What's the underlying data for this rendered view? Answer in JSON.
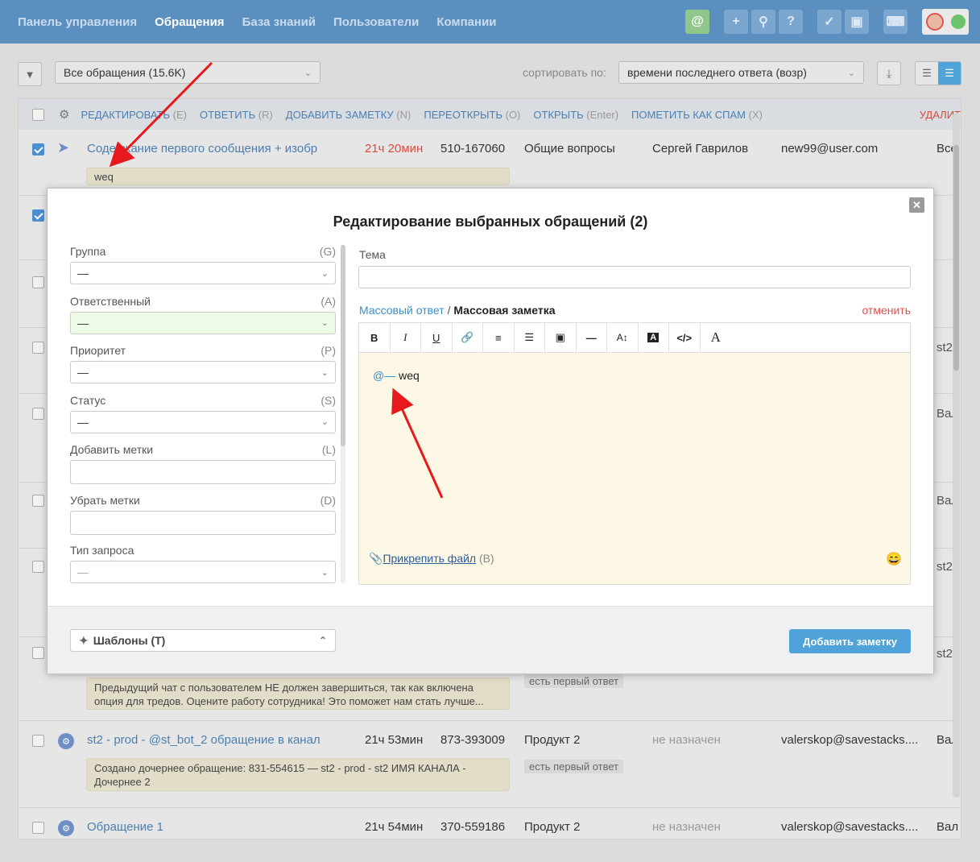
{
  "nav": {
    "links": [
      "Панель управления",
      "Обращения",
      "База знаний",
      "Пользователи",
      "Компании"
    ],
    "active": "Обращения"
  },
  "toolbar": {
    "filter_value": "Все обращения (15.6K)",
    "sort_label": "сортировать по:",
    "sort_value": "времени последнего ответа (возр)"
  },
  "actions": {
    "edit": "РЕДАКТИРОВАТЬ",
    "edit_key": "(E)",
    "reply": "ОТВЕТИТЬ",
    "reply_key": "(R)",
    "note": "ДОБАВИТЬ ЗАМЕТКУ",
    "note_key": "(N)",
    "reopen": "ПЕРЕОТКРЫТЬ",
    "reopen_key": "(O)",
    "open": "ОТКРЫТЬ",
    "open_key": "(Enter)",
    "spam": "ПОМЕТИТЬ КАК СПАМ",
    "spam_key": "(X)",
    "delete": "УДАЛИТ"
  },
  "rows": [
    {
      "subject": "Содержание первого сообщения + изобр",
      "time": "21ч 20мин",
      "id": "510-167060",
      "group": "Общие вопросы",
      "assignee": "Сергей Гаврилов",
      "email": "new99@user.com",
      "extra": "Все",
      "note": "weq"
    },
    {
      "note": "Предыдущий чат с пользователем НЕ должен завершиться, так как включена опция для тредов. Оцените работу сотрудника! Это поможет нам стать лучше...",
      "tag": "есть первый ответ"
    },
    {
      "subject": "st2 - prod - @st_bot_2 обращение в канал",
      "time": "21ч 53мин",
      "id": "873-393009",
      "group": "Продукт 2",
      "assignee": "не назначен",
      "email": "valerskop@savestacks....",
      "extra": "Вал",
      "note": "Создано дочернее обращение: 831-554615 — st2 - prod - st2 ИМЯ КАНАЛА - Дочернее 2",
      "tag": "есть первый ответ"
    },
    {
      "subject": "Обращение 1",
      "time": "21ч 54мин",
      "id": "370-559186",
      "group": "Продукт 2",
      "assignee": "не назначен",
      "email": "valerskop@savestacks....",
      "extra": "Вал"
    }
  ],
  "side_cut": [
    "st2",
    "Вал",
    "Вал",
    "st2",
    "st2"
  ],
  "modal": {
    "title": "Редактирование выбранных обращений (2)",
    "fields": [
      {
        "label": "Группа",
        "key": "(G)",
        "value": "—"
      },
      {
        "label": "Ответственный",
        "key": "(A)",
        "value": "—"
      },
      {
        "label": "Приоритет",
        "key": "(P)",
        "value": "—"
      },
      {
        "label": "Статус",
        "key": "(S)",
        "value": "—"
      },
      {
        "label": "Добавить метки",
        "key": "(L)",
        "value": ""
      },
      {
        "label": "Убрать метки",
        "key": "(D)",
        "value": ""
      },
      {
        "label": "Тип запроса",
        "key": "",
        "value": "—"
      }
    ],
    "subject_label": "Тема",
    "mode_reply": "Массовый ответ",
    "mode_sep": "/",
    "mode_note": "Массовая заметка",
    "cancel": "отменить",
    "editor_mention": "@—",
    "editor_text": "weq",
    "attach_label": "Прикрепить файл",
    "attach_key": "(B)",
    "templates": "Шаблоны (T)",
    "submit": "Добавить заметку"
  },
  "colors": {
    "nav_bg": "#5b8fc0",
    "accent": "#4fa3d9",
    "note_bg": "#fdf7e6",
    "danger": "#d9534f",
    "arrow": "#e8191c"
  }
}
